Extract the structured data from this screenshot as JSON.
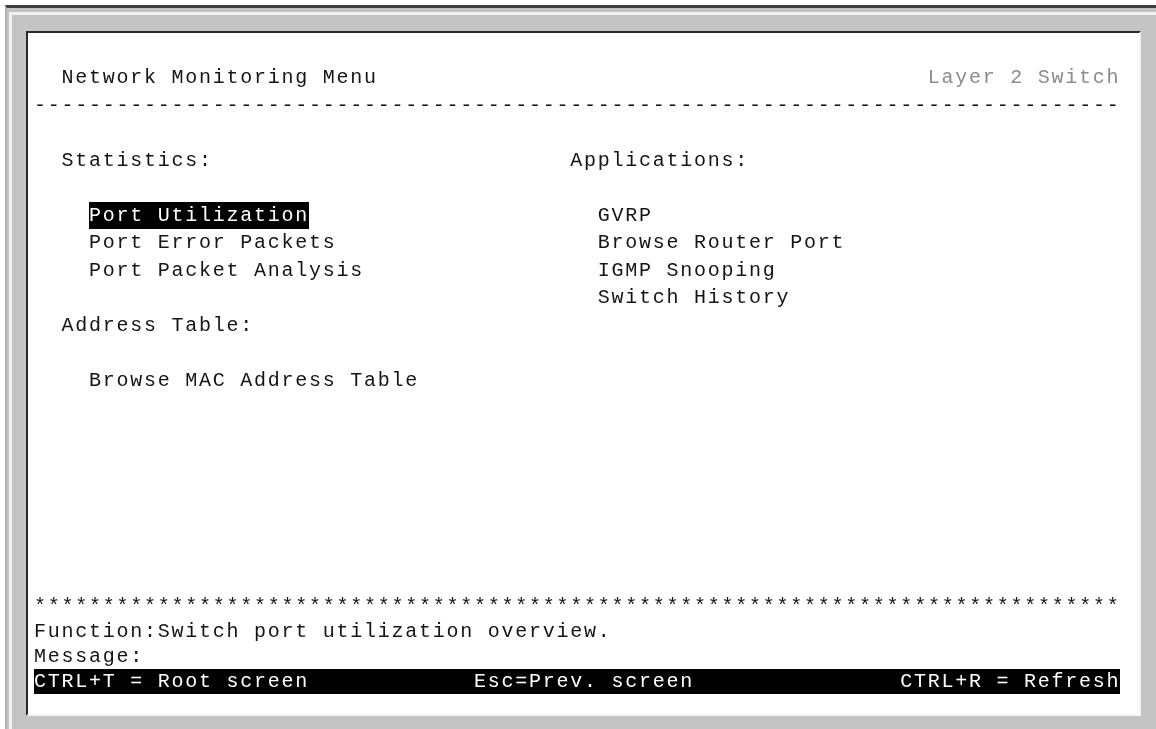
{
  "header": {
    "title": "Network Monitoring Menu",
    "device_label": "Layer 2 Switch",
    "rule": "-------------------------------------------------------------------------------"
  },
  "columns": [
    {
      "groups": [
        {
          "heading": "Statistics:",
          "items": [
            {
              "label": "Port Utilization",
              "selected": true
            },
            {
              "label": "Port Error Packets",
              "selected": false
            },
            {
              "label": "Port Packet Analysis",
              "selected": false
            }
          ]
        },
        {
          "heading": "Address Table:",
          "items": [
            {
              "label": "Browse MAC Address Table",
              "selected": false
            }
          ]
        }
      ]
    },
    {
      "groups": [
        {
          "heading": "Applications:",
          "items": [
            {
              "label": "GVRP",
              "selected": false
            },
            {
              "label": "Browse Router Port",
              "selected": false
            },
            {
              "label": "IGMP Snooping",
              "selected": false
            },
            {
              "label": "Switch History",
              "selected": false
            }
          ]
        }
      ]
    }
  ],
  "footer": {
    "rule": "*******************************************************************************",
    "function_line": "Function:Switch port utilization overview.",
    "message_label": "Message:",
    "hotkeys": [
      "CTRL+T = Root screen",
      "Esc=Prev. screen",
      "CTRL+R = Refresh"
    ]
  }
}
